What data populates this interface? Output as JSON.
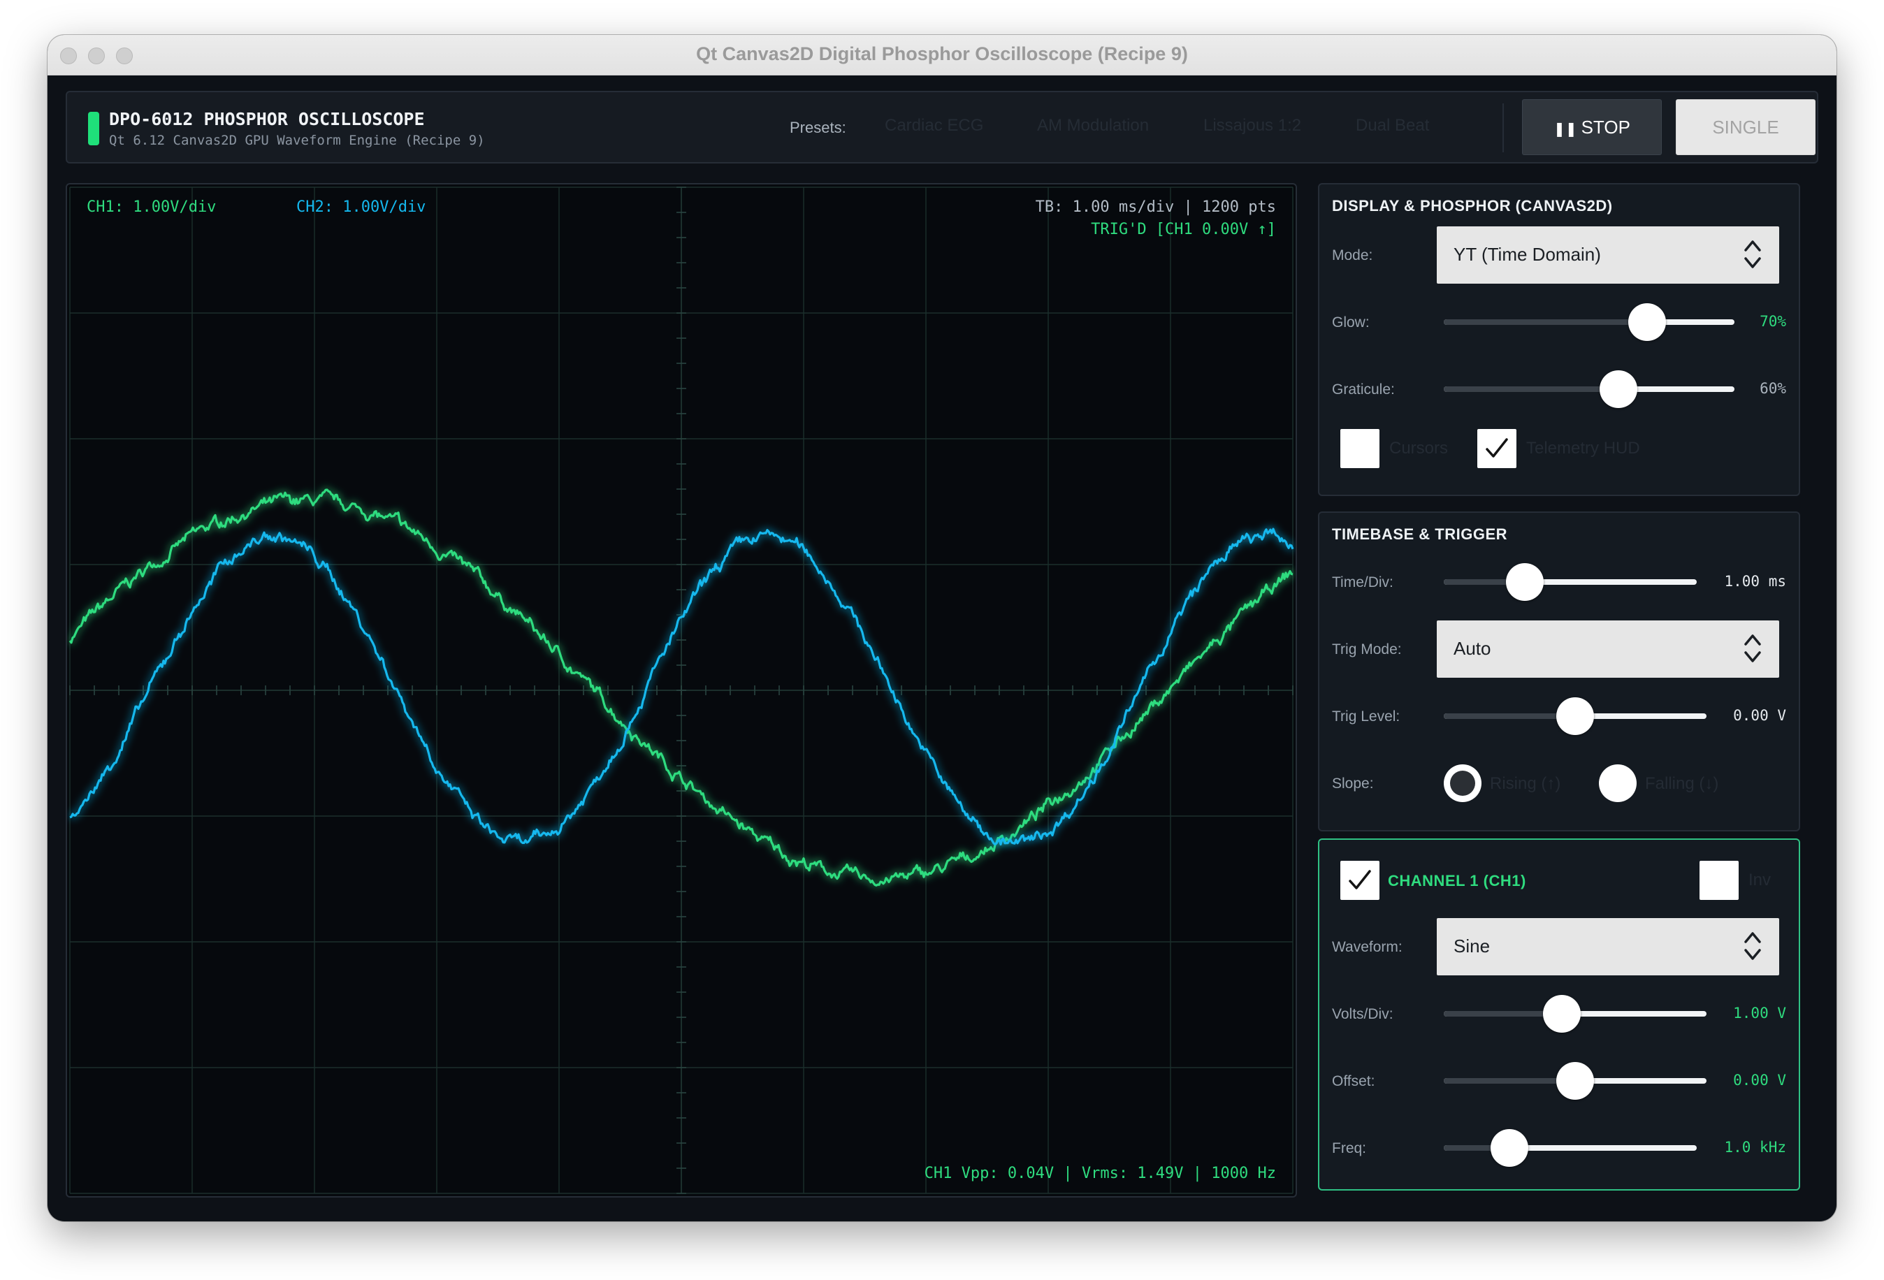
{
  "window": {
    "title": "Qt Canvas2D Digital Phosphor Oscilloscope (Recipe 9)"
  },
  "header": {
    "name": "DPO-6012 PHOSPHOR OSCILLOSCOPE",
    "subtitle": "Qt 6.12 Canvas2D GPU Waveform Engine (Recipe 9)",
    "presets_label": "Presets:",
    "presets": [
      "Cardiac ECG",
      "AM Modulation",
      "Lissajous 1:2",
      "Dual Beat"
    ],
    "stop_icon": "pause-icon",
    "stop_icon_glyph": "❚❚",
    "stop_label": "STOP",
    "single_label": "SINGLE"
  },
  "display": {
    "ch1_scale": "CH1: 1.00V/div",
    "ch2_scale": "CH2: 1.00V/div",
    "timebase": "TB: 1.00 ms/div | 1200 pts",
    "trigger_status": "TRIG'D [CH1 0.00V ↑]",
    "measurements": "CH1 Vpp: 0.04V | Vrms: 1.49V | 1000 Hz",
    "colors": {
      "ch1": "#2fdc7f",
      "ch2": "#14b8ee",
      "background": "#06090d",
      "grid": "#1b2f2c"
    },
    "grid_divisions": {
      "x": 10,
      "y": 8
    },
    "waveforms": {
      "ch1": {
        "type": "sine",
        "amplitude_div": 1.5,
        "period_div": 9.4,
        "phase_deg": 16,
        "noise": true
      },
      "ch2": {
        "type": "sine",
        "amplitude_div": 1.22,
        "period_div": 4.05,
        "phase_deg": -58,
        "noise": true
      }
    }
  },
  "panels": {
    "display_phosphor": {
      "title": "DISPLAY & PHOSPHOR (CANVAS2D)",
      "mode_label": "Mode:",
      "mode_value": "YT (Time Domain)",
      "glow_label": "Glow:",
      "glow_value": "70%",
      "glow_fraction": 0.7,
      "graticule_label": "Graticule:",
      "graticule_value": "60%",
      "graticule_fraction": 0.6,
      "cursors_label": "Cursors",
      "cursors_checked": false,
      "telemetry_label": "Telemetry HUD",
      "telemetry_checked": true
    },
    "timebase_trigger": {
      "title": "TIMEBASE & TRIGGER",
      "timediv_label": "Time/Div:",
      "timediv_value": "1.00 ms",
      "timediv_fraction": 0.32,
      "trigmode_label": "Trig Mode:",
      "trigmode_value": "Auto",
      "triglevel_label": "Trig Level:",
      "triglevel_value": "0.00 V",
      "triglevel_fraction": 0.5,
      "slope_label": "Slope:",
      "rising_label": "Rising (↑)",
      "falling_label": "Falling (↓)",
      "slope_selected": "rising"
    },
    "channel1": {
      "title": "CHANNEL 1 (CH1)",
      "enabled": true,
      "inv_label": "Inv",
      "inv_checked": false,
      "waveform_label": "Waveform:",
      "waveform_value": "Sine",
      "voltsdiv_label": "Volts/Div:",
      "voltsdiv_value": "1.00 V",
      "voltsdiv_fraction": 0.45,
      "offset_label": "Offset:",
      "offset_value": "0.00 V",
      "offset_fraction": 0.5,
      "freq_label": "Freq:",
      "freq_value": "1.0 kHz",
      "freq_fraction": 0.26
    }
  }
}
